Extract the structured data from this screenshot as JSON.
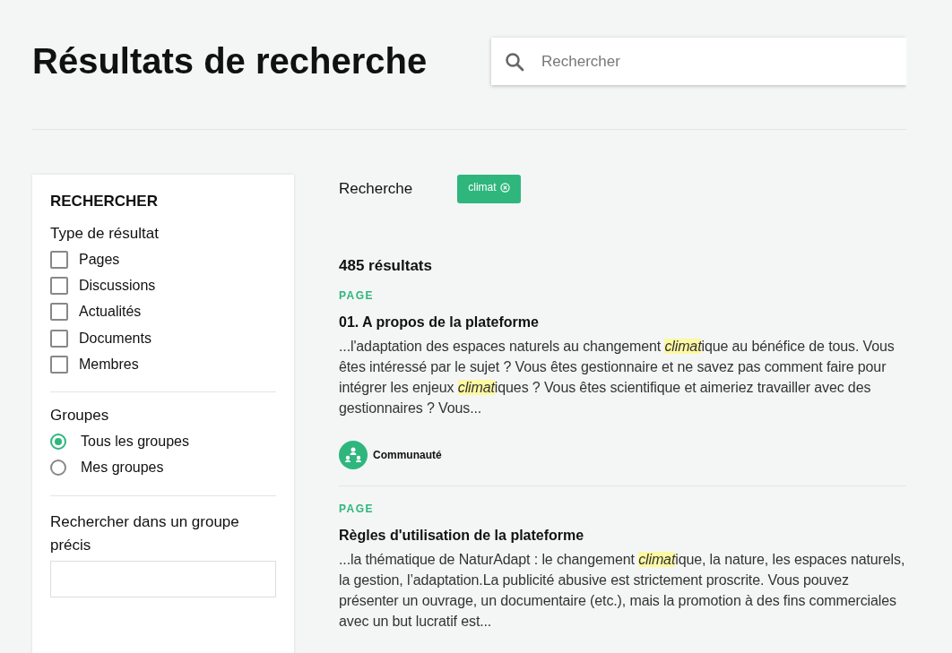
{
  "page_title": "Résultats de recherche",
  "search": {
    "placeholder": "Rechercher"
  },
  "sidebar": {
    "title": "RECHERCHER",
    "type_heading": "Type de résultat",
    "types": [
      {
        "label": "Pages",
        "checked": false
      },
      {
        "label": "Discussions",
        "checked": false
      },
      {
        "label": "Actualités",
        "checked": false
      },
      {
        "label": "Documents",
        "checked": false
      },
      {
        "label": "Membres",
        "checked": false
      }
    ],
    "groups_heading": "Groupes",
    "groups": [
      {
        "label": "Tous les groupes",
        "selected": true
      },
      {
        "label": "Mes groupes",
        "selected": false
      }
    ],
    "group_search_label": "Rechercher dans un groupe précis"
  },
  "query_label": "Recherche",
  "query_tags": [
    {
      "label": "climat"
    }
  ],
  "results_count": "485 résultats",
  "results": [
    {
      "type": "PAGE",
      "title": "01. A propos de la plateforme",
      "excerpt": [
        {
          "text": "...l'adaptation des espaces naturels au changement ",
          "highlight": false
        },
        {
          "text": "climat",
          "highlight": true
        },
        {
          "text": "ique au bénéfice de tous. Vous êtes intéressé par le sujet ? Vous êtes gestionnaire et ne savez pas comment faire pour intégrer les enjeux ",
          "highlight": false
        },
        {
          "text": "climat",
          "highlight": true
        },
        {
          "text": "iques ? Vous êtes scientifique et aimeriez travailler avec des gestionnaires ? Vous...",
          "highlight": false
        }
      ],
      "author": "Communauté"
    },
    {
      "type": "PAGE",
      "title": "Règles d'utilisation de la plateforme",
      "excerpt": [
        {
          "text": "...la thématique de NaturAdapt : le changement ",
          "highlight": false
        },
        {
          "text": "climat",
          "highlight": true
        },
        {
          "text": "ique, la nature, les espaces naturels, la gestion, l’adaptation.La publicité abusive est strictement proscrite. Vous pouvez présenter un ouvrage, un documentaire (etc.), mais la promotion à des fins commerciales avec un but lucratif est...",
          "highlight": false
        }
      ]
    }
  ]
}
